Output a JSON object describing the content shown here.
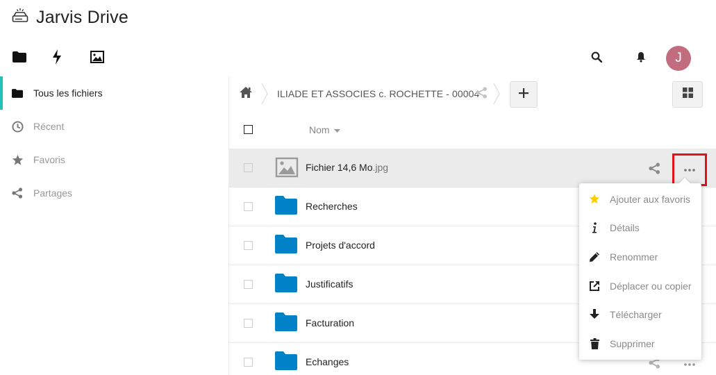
{
  "app": {
    "title": "Jarvis Drive",
    "logo_icon": "drive-icon"
  },
  "app_nav": [
    {
      "name": "files",
      "icon": "folder-icon"
    },
    {
      "name": "activity",
      "icon": "lightning-icon"
    },
    {
      "name": "gallery",
      "icon": "image-icon"
    }
  ],
  "header": {
    "avatar_initial": "J",
    "avatar_color": "#c26d7e"
  },
  "sidebar": {
    "accent_color": "#1fc2b4",
    "items": [
      {
        "label": "Tous les fichiers",
        "icon": "folder-icon",
        "active": true
      },
      {
        "label": "Récent",
        "icon": "clock-icon",
        "active": false
      },
      {
        "label": "Favoris",
        "icon": "star-icon",
        "active": false
      },
      {
        "label": "Partages",
        "icon": "share-icon",
        "active": false
      }
    ]
  },
  "breadcrumb": {
    "current": "ILIADE ET ASSOCIES c. ROCHETTE - 00004"
  },
  "list": {
    "sort_label": "Nom",
    "files": [
      {
        "base": "Fichier 14,6 Mo",
        "ext": ".jpg",
        "type": "image",
        "selected": true
      },
      {
        "base": "Recherches",
        "ext": "",
        "type": "folder"
      },
      {
        "base": "Projets d'accord",
        "ext": "",
        "type": "folder"
      },
      {
        "base": "Justificatifs",
        "ext": "",
        "type": "folder"
      },
      {
        "base": "Facturation",
        "ext": "",
        "type": "folder"
      },
      {
        "base": "Echanges",
        "ext": "",
        "type": "folder"
      }
    ]
  },
  "context_menu": {
    "items": [
      {
        "label": "Ajouter aux favoris",
        "icon": "star-icon"
      },
      {
        "label": "Détails",
        "icon": "info-icon"
      },
      {
        "label": "Renommer",
        "icon": "pencil-icon"
      },
      {
        "label": "Déplacer ou copier",
        "icon": "external-link-icon"
      },
      {
        "label": "Télécharger",
        "icon": "download-icon"
      },
      {
        "label": "Supprimer",
        "icon": "trash-icon"
      }
    ]
  },
  "colors": {
    "folder": "#0082c9",
    "highlight": "#e3111a",
    "star": "#fc0"
  }
}
